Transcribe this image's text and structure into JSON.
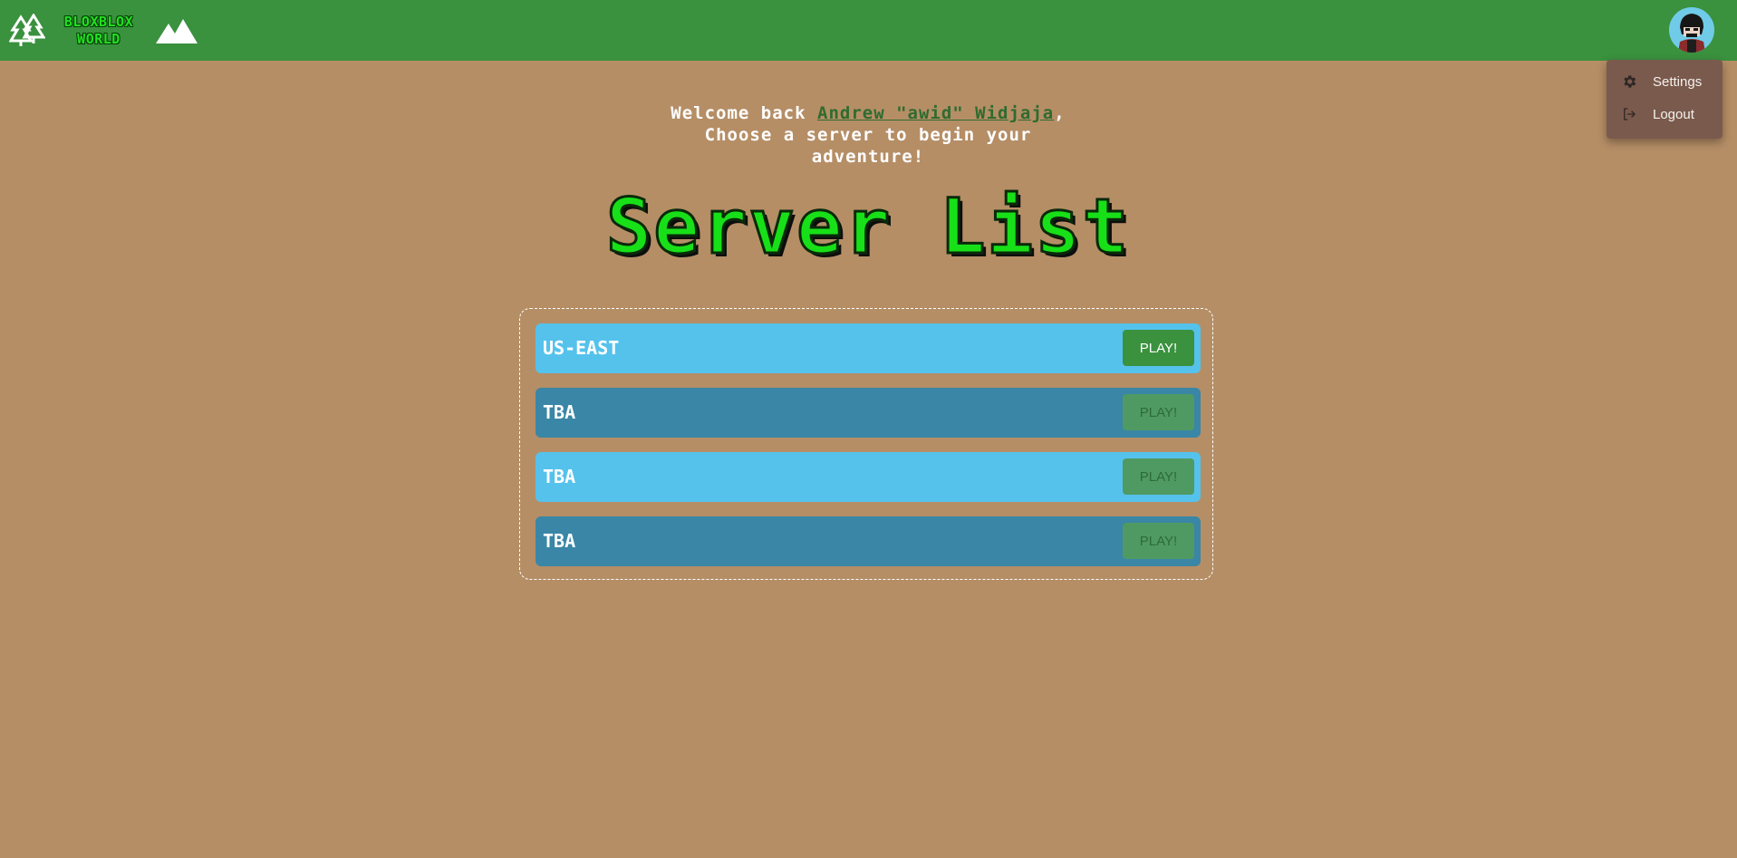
{
  "header": {
    "logo_line1": "BLOXBLOX",
    "logo_line2": "WORLD",
    "logo_icon": "trees-icon",
    "nav_icon": "mountain-icon",
    "avatar_icon": "avatar"
  },
  "user_menu": {
    "items": [
      {
        "label": "Settings",
        "icon": "gear-icon"
      },
      {
        "label": "Logout",
        "icon": "logout-icon"
      }
    ]
  },
  "welcome": {
    "prefix": "Welcome back ",
    "username": "Andrew \"awid\" Widjaja",
    "suffix": ",",
    "line2": "Choose a server to begin your",
    "line3": "adventure!"
  },
  "page_title": "Server List",
  "servers": [
    {
      "name": "US-EAST",
      "play_label": "PLAY!",
      "enabled": true
    },
    {
      "name": "TBA",
      "play_label": "PLAY!",
      "enabled": false
    },
    {
      "name": "TBA",
      "play_label": "PLAY!",
      "enabled": false
    },
    {
      "name": "TBA",
      "play_label": "PLAY!",
      "enabled": false
    }
  ],
  "colors": {
    "background": "#b58e66",
    "topbar": "#3a913e",
    "row_light": "#55c2ec",
    "row_dark": "#3a86a6",
    "title_green": "#18e018",
    "menu_bg": "#7a5a4d"
  }
}
